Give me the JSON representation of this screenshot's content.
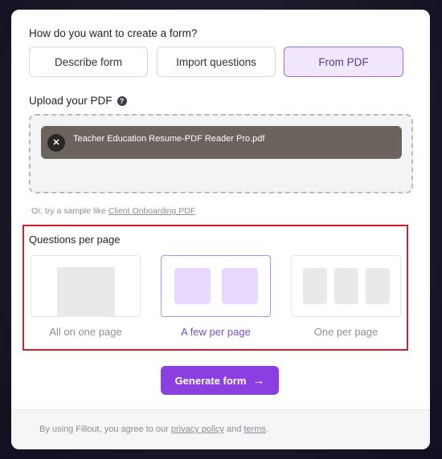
{
  "form_mode": {
    "question": "How do you want to create a form?",
    "options": [
      {
        "label": "Describe form",
        "selected": false
      },
      {
        "label": "Import questions",
        "selected": false
      },
      {
        "label": "From PDF",
        "selected": true
      }
    ]
  },
  "upload": {
    "title": "Upload your PDF",
    "help_icon": "question-circle-icon",
    "file_name": "Teacher Education Resume-PDF Reader Pro.pdf",
    "remove_icon": "close-icon"
  },
  "sample": {
    "prefix": "Or, try a sample like",
    "link": "Client Onboarding PDF"
  },
  "questions_per_page": {
    "title": "Questions per page",
    "options": [
      {
        "label": "All on one page",
        "selected": false
      },
      {
        "label": "A few per page",
        "selected": true
      },
      {
        "label": "One per page",
        "selected": false
      }
    ]
  },
  "generate": {
    "label": "Generate form",
    "icon": "arrow-right-icon"
  },
  "footer": {
    "prefix": "By using Fillout, you agree to our",
    "privacy_link": "privacy policy",
    "and": "and",
    "terms_link": "terms",
    "suffix": "."
  },
  "colors": {
    "accent": "#8b3fe0",
    "selected_bg": "#f1e8ff",
    "highlight_border": "#d1202b"
  }
}
